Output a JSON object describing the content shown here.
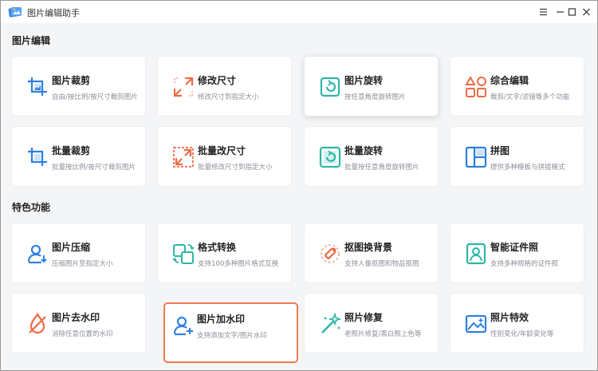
{
  "app": {
    "title": "图片编辑助手",
    "controls": {
      "menu": "≡",
      "minimize": "—",
      "maximize": "□",
      "close": "✕"
    }
  },
  "sections": [
    {
      "title": "图片编辑"
    },
    {
      "title": "特色功能"
    }
  ],
  "cards": [
    {
      "title": "图片裁剪",
      "desc": "自由/按比例/按尺寸裁剪图片",
      "icon": "crop-icon"
    },
    {
      "title": "修改尺寸",
      "desc": "修改尺寸到指定大小",
      "icon": "resize-icon"
    },
    {
      "title": "图片旋转",
      "desc": "按任意角度旋转图片",
      "icon": "rotate-icon"
    },
    {
      "title": "综合编辑",
      "desc": "裁剪/文字/滤镜等多个功能",
      "icon": "shapes-icon"
    },
    {
      "title": "批量裁剪",
      "desc": "批量按比例/按尺寸裁剪图片",
      "icon": "batch-crop-icon"
    },
    {
      "title": "批量改尺寸",
      "desc": "批量修改尺寸到指定大小",
      "icon": "batch-resize-icon"
    },
    {
      "title": "批量旋转",
      "desc": "批量按任意角度旋转图片",
      "icon": "batch-rotate-icon"
    },
    {
      "title": "拼图",
      "desc": "提供多种模板与拼接模式",
      "icon": "collage-icon"
    },
    {
      "title": "图片压缩",
      "desc": "压缩图片至指定大小",
      "icon": "compress-icon"
    },
    {
      "title": "格式转换",
      "desc": "支持100多种图片格式互换",
      "icon": "convert-icon"
    },
    {
      "title": "抠图换背景",
      "desc": "支持人像抠图和物品抠图",
      "icon": "cutout-icon"
    },
    {
      "title": "智能证件照",
      "desc": "支持多种规格的证件照",
      "icon": "id-photo-icon"
    },
    {
      "title": "图片去水印",
      "desc": "消除任意位置的水印",
      "icon": "remove-watermark-icon"
    },
    {
      "title": "图片加水印",
      "desc": "支持添加文字/图片水印",
      "icon": "add-watermark-icon"
    },
    {
      "title": "照片修复",
      "desc": "老照片修复/黑白照上色等",
      "icon": "magic-wand-icon"
    },
    {
      "title": "照片特效",
      "desc": "性别变化/年龄变化等",
      "icon": "photo-effect-icon"
    }
  ],
  "colors": {
    "blue": "#2f7fe0",
    "orange": "#ee6a45",
    "teal": "#2eb6a6",
    "selected_border": "#ee7a54"
  }
}
